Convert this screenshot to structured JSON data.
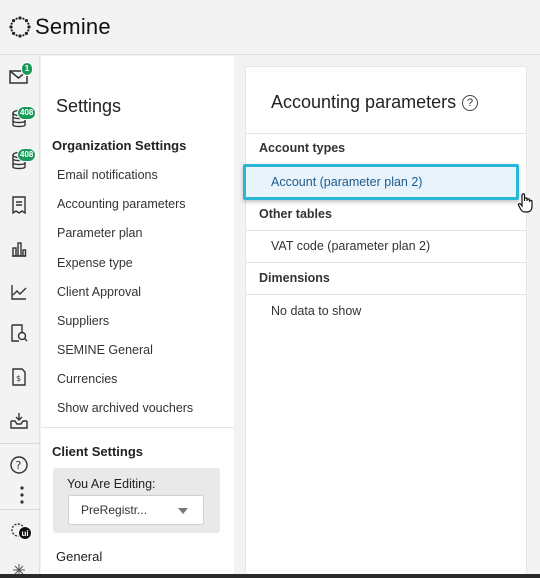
{
  "app": {
    "name": "Semine"
  },
  "rail": {
    "items": [
      {
        "icon": "mail-icon",
        "badge": "1"
      },
      {
        "icon": "coins-icon",
        "badge": "408"
      },
      {
        "icon": "coins-alt-icon",
        "badge": "408"
      },
      {
        "icon": "receipt-icon"
      },
      {
        "icon": "bar-chart-icon"
      },
      {
        "icon": "line-chart-icon"
      },
      {
        "icon": "search-document-icon"
      },
      {
        "icon": "invoice-icon"
      },
      {
        "icon": "inbox-download-icon"
      },
      {
        "icon": "help-icon"
      },
      {
        "icon": "more-vertical-icon"
      },
      {
        "icon": "ui-settings-icon",
        "badge": "ui"
      },
      {
        "icon": "sparkle-icon"
      }
    ]
  },
  "settings": {
    "title": "Settings",
    "organization_heading": "Organization Settings",
    "organization_items": [
      "Email notifications",
      "Accounting parameters",
      "Parameter plan",
      "Expense type",
      "Client Approval",
      "Suppliers",
      "SEMINE General",
      "Currencies",
      "Show archived vouchers"
    ],
    "client_heading": "Client Settings",
    "editing_label": "You Are Editing:",
    "editing_value": "PreRegistr...",
    "general_heading": "General"
  },
  "accounting": {
    "title": "Accounting parameters",
    "help": "?",
    "account_types_heading": "Account types",
    "account_types_items": [
      "Account (parameter plan 2)"
    ],
    "other_tables_heading": "Other tables",
    "other_tables_items": [
      "VAT code (parameter plan 2)"
    ],
    "dimensions_heading": "Dimensions",
    "dimensions_empty": "No data to show"
  },
  "colors": {
    "accent": "#27b6d6",
    "badge": "#1a9a5a",
    "selected_bg": "#e8f3fb"
  }
}
